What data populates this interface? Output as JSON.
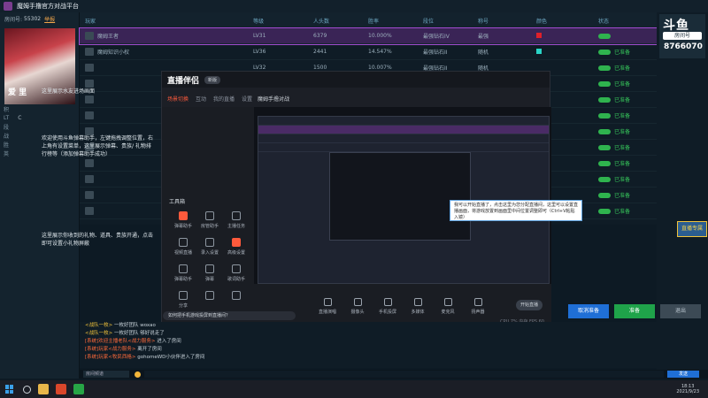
{
  "titlebar": {
    "title": "魔姆手撸官方对战平台"
  },
  "room": {
    "label": "房间号:",
    "id": "55302",
    "link": "举报"
  },
  "avatar_tag": "爱 里",
  "left_stats": [
    {
      "k": "积",
      "v": ""
    },
    {
      "k": "LT",
      "v": "C"
    },
    {
      "k": "段",
      "v": ""
    },
    {
      "k": "战",
      "v": ""
    },
    {
      "k": "胜",
      "v": ""
    },
    {
      "k": "英",
      "v": ""
    }
  ],
  "table": {
    "headers": [
      "玩家",
      "等级",
      "人头数",
      "胜率",
      "段位",
      "称号",
      "颜色",
      "状态"
    ],
    "rows": [
      {
        "name": "魔姆王者",
        "lv": "LV31",
        "n": "6379",
        "rate": "10.000%",
        "rank": "最强钻石IV",
        "title": "最强",
        "color": "#e0202a",
        "status": "",
        "selected": true
      },
      {
        "name": "魔姆知识小权",
        "lv": "LV36",
        "n": "2441",
        "rate": "14.547%",
        "rank": "最强钻石II",
        "title": "随机",
        "color": "#2ad4c6",
        "status": "已准备",
        "selected": false
      },
      {
        "name": "",
        "lv": "LV32",
        "n": "1500",
        "rate": "10.007%",
        "rank": "最强钻石II",
        "title": "随机",
        "color": "",
        "status": "已准备",
        "selected": false
      },
      {
        "name": "",
        "lv": "",
        "n": "",
        "rate": "",
        "rank": "",
        "title": "",
        "color": "",
        "status": "已准备",
        "selected": false
      },
      {
        "name": "",
        "lv": "",
        "n": "",
        "rate": "",
        "rank": "",
        "title": "",
        "color": "",
        "status": "已准备",
        "selected": false
      },
      {
        "name": "",
        "lv": "",
        "n": "",
        "rate": "",
        "rank": "",
        "title": "",
        "color": "",
        "status": "已准备",
        "selected": false
      },
      {
        "name": "",
        "lv": "",
        "n": "",
        "rate": "",
        "rank": "",
        "title": "",
        "color": "",
        "status": "已准备",
        "selected": false
      },
      {
        "name": "",
        "lv": "",
        "n": "",
        "rate": "",
        "rank": "",
        "title": "",
        "color": "",
        "status": "已准备",
        "selected": false
      },
      {
        "name": "",
        "lv": "",
        "n": "",
        "rate": "",
        "rank": "",
        "title": "",
        "color": "",
        "status": "已准备",
        "selected": false
      },
      {
        "name": "",
        "lv": "",
        "n": "",
        "rate": "",
        "rank": "",
        "title": "",
        "color": "",
        "status": "已准备",
        "selected": false
      },
      {
        "name": "",
        "lv": "",
        "n": "",
        "rate": "",
        "rank": "",
        "title": "",
        "color": "",
        "status": "已准备",
        "selected": false
      },
      {
        "name": "",
        "lv": "",
        "n": "",
        "rate": "",
        "rank": "",
        "title": "",
        "color": "",
        "status": "已准备",
        "selected": false
      }
    ]
  },
  "right": {
    "brand": "斗鱼",
    "badge": "房间号",
    "room_num": "8766070",
    "gold": "直播专属"
  },
  "tips": {
    "a": "这里展示水友进场画面",
    "b": "欢迎使用斗鱼弹幕助手，左键拖拽调整位置，右上角有设置菜单，这里展示弹幕、贵族/ 礼物排行榜等（添加弹幕助手成功）",
    "c": "这里展示你收到的礼物、道具、贵族开通，点击即可设置小礼物屏蔽"
  },
  "companion": {
    "brand": "直播伴侣",
    "badge": "新版",
    "tabs": [
      "场景切换",
      "互动",
      "我的直播",
      "设置"
    ],
    "preview_title": "魔姆手撸对战",
    "tools_label": "工具箱",
    "tools": [
      "弹幕助手",
      "房管助手",
      "主播任务",
      "视频直播",
      "录入设置",
      "高级设置",
      "弹幕助手",
      "弹幕",
      "歌词助手",
      "分享",
      "",
      ""
    ],
    "bottom": [
      "直播演唱",
      "摄像头",
      "手机投屏",
      "多媒体",
      "麦克风",
      "扬声器"
    ],
    "start": "开始直播",
    "status": "CPU 7%  内存  FPS 60",
    "hint": "如何把手机游戏投屏到直播间？"
  },
  "tooltip": "我可以开始直播了，点击这里为您分配直播间，这里可以设置直播画面，将游戏放置到画面里中间位置调整即可（Ctrl+V粘贴入镜）",
  "actions": {
    "cancel": "取消准备",
    "ready": "准备",
    "exit": "退出"
  },
  "chat": [
    {
      "who": "<战队一枚>",
      "sys": "",
      "txt": "一枚好团队 woxao"
    },
    {
      "who": "<战队一枚>",
      "sys": "",
      "txt": "一枚好团队 够好说走了"
    },
    {
      "who": "",
      "sys": "[系统]欢迎主播老队<战力服务>",
      "txt": "进入了房间"
    },
    {
      "who": "",
      "sys": "[系统]玩家<战力服务>",
      "txt": "离开了房间"
    },
    {
      "who": "",
      "sys": "[系统]玩家<牧民西格>",
      "txt": "gohomeWD小伙伴进入了房间"
    }
  ],
  "input": {
    "channel": "房间频道",
    "send": "发送"
  },
  "taskbar": {
    "time": "18:13",
    "date": "2021/9/23"
  }
}
